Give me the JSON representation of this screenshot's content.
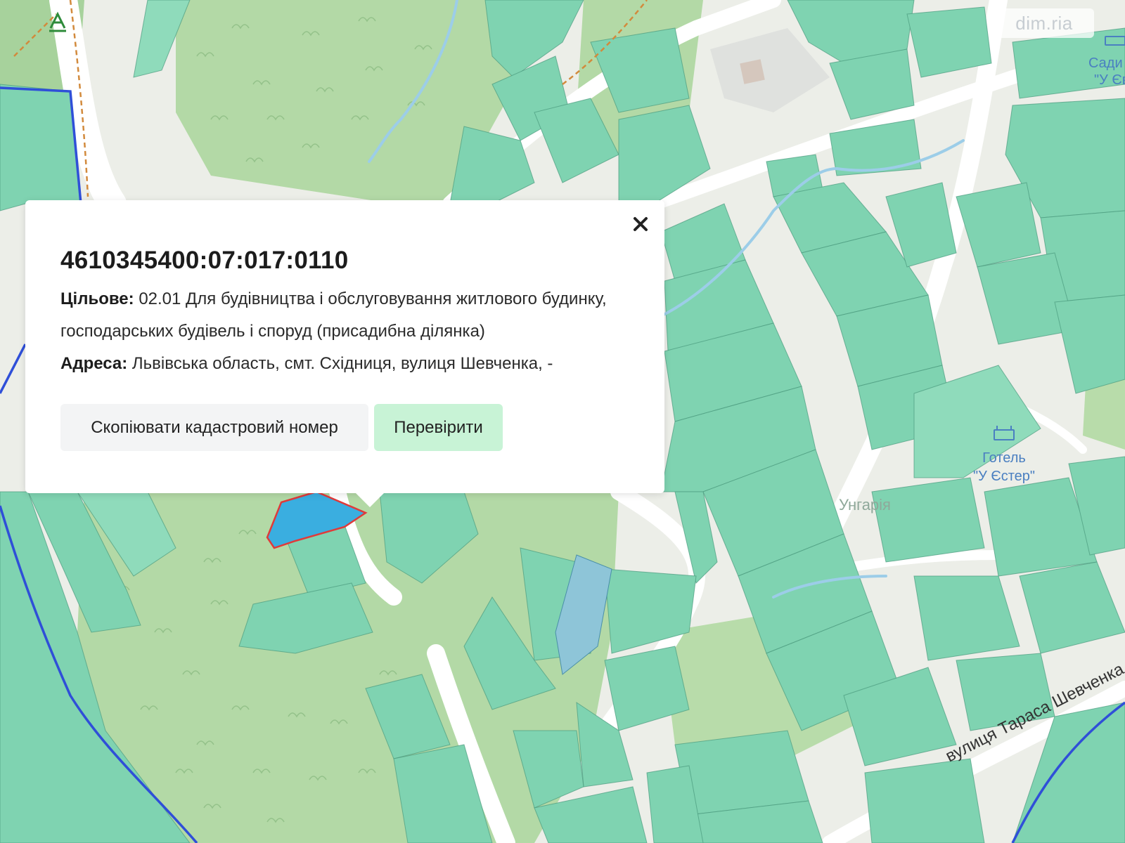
{
  "watermark": "dim.ria",
  "popup": {
    "cadastral_number": "4610345400:07:017:0110",
    "purpose_label": "Цільове:",
    "purpose_value": "02.01 Для будівництва і обслуговування житлового будинку, господарських будівель і споруд (присадибна ділянка)",
    "address_label": "Адреса:",
    "address_value": "Львівська область, смт. Східниця, вулиця Шевченка, -",
    "copy_button": "Скопіювати кадастровий номер",
    "check_button": "Перевірити",
    "close_icon": "close-icon"
  },
  "map": {
    "labels": {
      "street": "вулиця Тараса Шевченка",
      "hotel_name": "Готель",
      "hotel_name_2": "\"У Єстер\"",
      "locality": "Унгарія",
      "corner_1": "Сади",
      "corner_2": "\"У Єв"
    },
    "colors": {
      "forest": "#a9d4a0",
      "parcel": "#77cfac",
      "parcel_dark": "#5cbf98",
      "road": "#ffffff",
      "land": "#eceee8",
      "stream": "#9ccde8",
      "boundary": "#2f4fd8",
      "selected": "#3aaee0",
      "selected_outline": "#e03a3a",
      "water": "#8ec5d8"
    },
    "icons": [
      "hotel-icon",
      "trail-marker-icon",
      "tree-icon"
    ]
  }
}
